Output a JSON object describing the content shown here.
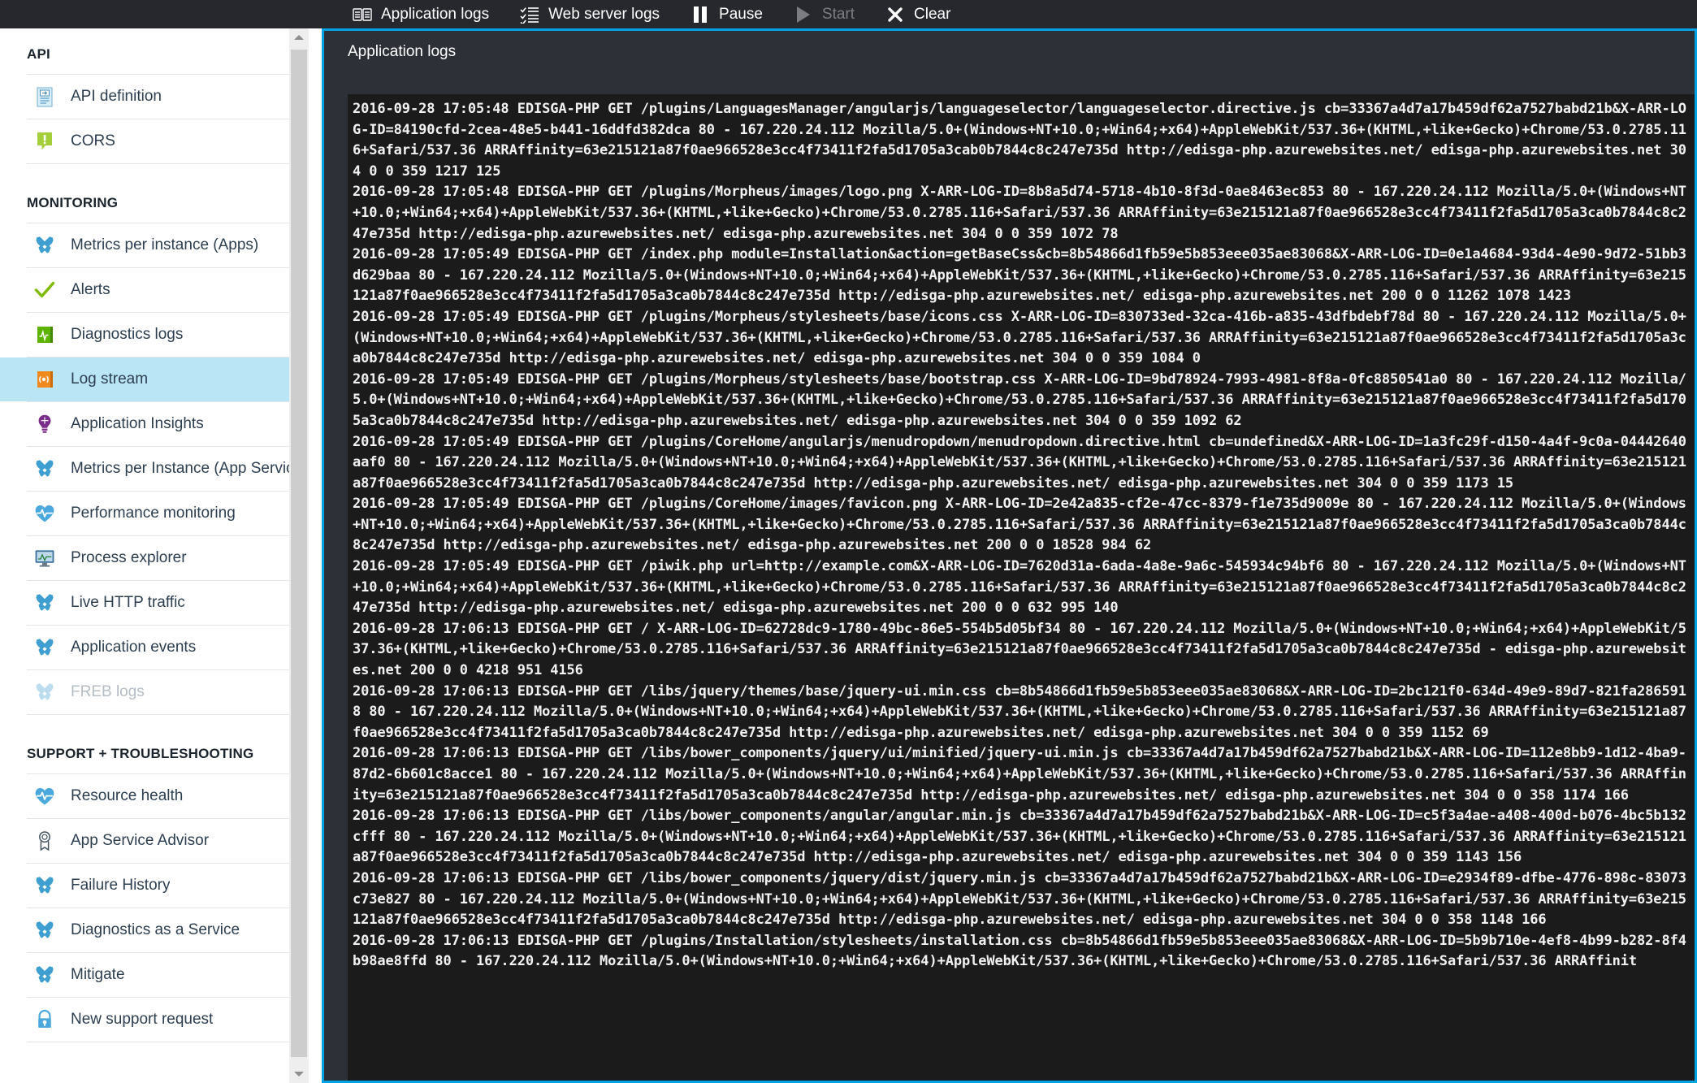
{
  "toolbar": {
    "buttons": [
      {
        "label": "Application logs",
        "icon": "book-icon",
        "disabled": false
      },
      {
        "label": "Web server logs",
        "icon": "checklist-icon",
        "disabled": false
      },
      {
        "label": "Pause",
        "icon": "pause-icon",
        "disabled": false
      },
      {
        "label": "Start",
        "icon": "play-icon",
        "disabled": true
      },
      {
        "label": "Clear",
        "icon": "close-x-icon",
        "disabled": false
      }
    ]
  },
  "sidebar": {
    "groups": [
      {
        "title": "API",
        "items": [
          {
            "label": "API definition",
            "icon": "api-definition-icon",
            "selected": false,
            "disabled": false
          },
          {
            "label": "CORS",
            "icon": "cors-icon",
            "selected": false,
            "disabled": false
          }
        ]
      },
      {
        "title": "MONITORING",
        "items": [
          {
            "label": "Metrics per instance (Apps)",
            "icon": "tools-icon",
            "selected": false,
            "disabled": false
          },
          {
            "label": "Alerts",
            "icon": "checkmark-icon",
            "selected": false,
            "disabled": false
          },
          {
            "label": "Diagnostics logs",
            "icon": "diagnostics-logs-icon",
            "selected": false,
            "disabled": false
          },
          {
            "label": "Log stream",
            "icon": "log-stream-icon",
            "selected": true,
            "disabled": false
          },
          {
            "label": "Application Insights",
            "icon": "lightbulb-icon",
            "selected": false,
            "disabled": false
          },
          {
            "label": "Metrics per Instance (App Servic...",
            "icon": "tools-icon",
            "selected": false,
            "disabled": false
          },
          {
            "label": "Performance monitoring",
            "icon": "heart-pulse-icon",
            "selected": false,
            "disabled": false
          },
          {
            "label": "Process explorer",
            "icon": "monitor-icon",
            "selected": false,
            "disabled": false
          },
          {
            "label": "Live HTTP traffic",
            "icon": "tools-icon",
            "selected": false,
            "disabled": false
          },
          {
            "label": "Application events",
            "icon": "tools-icon",
            "selected": false,
            "disabled": false
          },
          {
            "label": "FREB logs",
            "icon": "tools-icon",
            "selected": false,
            "disabled": true
          }
        ]
      },
      {
        "title": "SUPPORT + TROUBLESHOOTING",
        "items": [
          {
            "label": "Resource health",
            "icon": "heart-pulse-icon",
            "selected": false,
            "disabled": false
          },
          {
            "label": "App Service Advisor",
            "icon": "ribbon-icon",
            "selected": false,
            "disabled": false
          },
          {
            "label": "Failure History",
            "icon": "tools-icon",
            "selected": false,
            "disabled": false
          },
          {
            "label": "Diagnostics as a Service",
            "icon": "tools-icon",
            "selected": false,
            "disabled": false
          },
          {
            "label": "Mitigate",
            "icon": "tools-icon",
            "selected": false,
            "disabled": false
          },
          {
            "label": "New support request",
            "icon": "support-request-icon",
            "selected": false,
            "disabled": false
          }
        ]
      }
    ]
  },
  "log_panel": {
    "title": "Application logs",
    "lines": [
      "2016-09-28 17:05:48 EDISGA-PHP GET /plugins/LanguagesManager/angularjs/languageselector/languageselector.directive.js cb=33367a4d7a17b459df62a7527babd21b&X-ARR-LOG-ID=84190cfd-2cea-48e5-b441-16ddfd382dca 80 - 167.220.24.112 Mozilla/5.0+(Windows+NT+10.0;+Win64;+x64)+AppleWebKit/537.36+(KHTML,+like+Gecko)+Chrome/53.0.2785.116+Safari/537.36 ARRAffinity=63e215121a87f0ae966528e3cc4f73411f2fa5d1705a3cab0b7844c8c247e735d http://edisga-php.azurewebsites.net/ edisga-php.azurewebsites.net 304 0 0 359 1217 125",
      "2016-09-28 17:05:48 EDISGA-PHP GET /plugins/Morpheus/images/logo.png X-ARR-LOG-ID=8b8a5d74-5718-4b10-8f3d-0ae8463ec853 80 - 167.220.24.112 Mozilla/5.0+(Windows+NT+10.0;+Win64;+x64)+AppleWebKit/537.36+(KHTML,+like+Gecko)+Chrome/53.0.2785.116+Safari/537.36 ARRAffinity=63e215121a87f0ae966528e3cc4f73411f2fa5d1705a3ca0b7844c8c247e735d http://edisga-php.azurewebsites.net/ edisga-php.azurewebsites.net 304 0 0 359 1072 78",
      "2016-09-28 17:05:49 EDISGA-PHP GET /index.php module=Installation&action=getBaseCss&cb=8b54866d1fb59e5b853eee035ae83068&X-ARR-LOG-ID=0e1a4684-93d4-4e90-9d72-51bb3d629baa 80 - 167.220.24.112 Mozilla/5.0+(Windows+NT+10.0;+Win64;+x64)+AppleWebKit/537.36+(KHTML,+like+Gecko)+Chrome/53.0.2785.116+Safari/537.36 ARRAffinity=63e215121a87f0ae966528e3cc4f73411f2fa5d1705a3ca0b7844c8c247e735d http://edisga-php.azurewebsites.net/ edisga-php.azurewebsites.net 200 0 0 11262 1078 1423",
      "2016-09-28 17:05:49 EDISGA-PHP GET /plugins/Morpheus/stylesheets/base/icons.css X-ARR-LOG-ID=830733ed-32ca-416b-a835-43dfbdebf78d 80 - 167.220.24.112 Mozilla/5.0+(Windows+NT+10.0;+Win64;+x64)+AppleWebKit/537.36+(KHTML,+like+Gecko)+Chrome/53.0.2785.116+Safari/537.36 ARRAffinity=63e215121a87f0ae966528e3cc4f73411f2fa5d1705a3ca0b7844c8c247e735d http://edisga-php.azurewebsites.net/ edisga-php.azurewebsites.net 304 0 0 359 1084 0",
      "2016-09-28 17:05:49 EDISGA-PHP GET /plugins/Morpheus/stylesheets/base/bootstrap.css X-ARR-LOG-ID=9bd78924-7993-4981-8f8a-0fc8850541a0 80 - 167.220.24.112 Mozilla/5.0+(Windows+NT+10.0;+Win64;+x64)+AppleWebKit/537.36+(KHTML,+like+Gecko)+Chrome/53.0.2785.116+Safari/537.36 ARRAffinity=63e215121a87f0ae966528e3cc4f73411f2fa5d1705a3ca0b7844c8c247e735d http://edisga-php.azurewebsites.net/ edisga-php.azurewebsites.net 304 0 0 359 1092 62",
      "2016-09-28 17:05:49 EDISGA-PHP GET /plugins/CoreHome/angularjs/menudropdown/menudropdown.directive.html cb=undefined&X-ARR-LOG-ID=1a3fc29f-d150-4a4f-9c0a-04442640aaf0 80 - 167.220.24.112 Mozilla/5.0+(Windows+NT+10.0;+Win64;+x64)+AppleWebKit/537.36+(KHTML,+like+Gecko)+Chrome/53.0.2785.116+Safari/537.36 ARRAffinity=63e215121a87f0ae966528e3cc4f73411f2fa5d1705a3ca0b7844c8c247e735d http://edisga-php.azurewebsites.net/ edisga-php.azurewebsites.net 304 0 0 359 1173 15",
      "2016-09-28 17:05:49 EDISGA-PHP GET /plugins/CoreHome/images/favicon.png X-ARR-LOG-ID=2e42a835-cf2e-47cc-8379-f1e735d9009e 80 - 167.220.24.112 Mozilla/5.0+(Windows+NT+10.0;+Win64;+x64)+AppleWebKit/537.36+(KHTML,+like+Gecko)+Chrome/53.0.2785.116+Safari/537.36 ARRAffinity=63e215121a87f0ae966528e3cc4f73411f2fa5d1705a3ca0b7844c8c247e735d http://edisga-php.azurewebsites.net/ edisga-php.azurewebsites.net 200 0 0 18528 984 62",
      "2016-09-28 17:05:49 EDISGA-PHP GET /piwik.php url=http://example.com&X-ARR-LOG-ID=7620d31a-6ada-4a8e-9a6c-545934c94bf6 80 - 167.220.24.112 Mozilla/5.0+(Windows+NT+10.0;+Win64;+x64)+AppleWebKit/537.36+(KHTML,+like+Gecko)+Chrome/53.0.2785.116+Safari/537.36 ARRAffinity=63e215121a87f0ae966528e3cc4f73411f2fa5d1705a3ca0b7844c8c247e735d http://edisga-php.azurewebsites.net/ edisga-php.azurewebsites.net 200 0 0 632 995 140",
      "2016-09-28 17:06:13 EDISGA-PHP GET / X-ARR-LOG-ID=62728dc9-1780-49bc-86e5-554b5d05bf34 80 - 167.220.24.112 Mozilla/5.0+(Windows+NT+10.0;+Win64;+x64)+AppleWebKit/537.36+(KHTML,+like+Gecko)+Chrome/53.0.2785.116+Safari/537.36 ARRAffinity=63e215121a87f0ae966528e3cc4f73411f2fa5d1705a3ca0b7844c8c247e735d - edisga-php.azurewebsites.net 200 0 0 4218 951 4156",
      "2016-09-28 17:06:13 EDISGA-PHP GET /libs/jquery/themes/base/jquery-ui.min.css cb=8b54866d1fb59e5b853eee035ae83068&X-ARR-LOG-ID=2bc121f0-634d-49e9-89d7-821fa2865918 80 - 167.220.24.112 Mozilla/5.0+(Windows+NT+10.0;+Win64;+x64)+AppleWebKit/537.36+(KHTML,+like+Gecko)+Chrome/53.0.2785.116+Safari/537.36 ARRAffinity=63e215121a87f0ae966528e3cc4f73411f2fa5d1705a3ca0b7844c8c247e735d http://edisga-php.azurewebsites.net/ edisga-php.azurewebsites.net 304 0 0 359 1152 69",
      "2016-09-28 17:06:13 EDISGA-PHP GET /libs/bower_components/jquery/ui/minified/jquery-ui.min.js cb=33367a4d7a17b459df62a7527babd21b&X-ARR-LOG-ID=112e8bb9-1d12-4ba9-87d2-6b601c8acce1 80 - 167.220.24.112 Mozilla/5.0+(Windows+NT+10.0;+Win64;+x64)+AppleWebKit/537.36+(KHTML,+like+Gecko)+Chrome/53.0.2785.116+Safari/537.36 ARRAffinity=63e215121a87f0ae966528e3cc4f73411f2fa5d1705a3ca0b7844c8c247e735d http://edisga-php.azurewebsites.net/ edisga-php.azurewebsites.net 304 0 0 358 1174 166",
      "2016-09-28 17:06:13 EDISGA-PHP GET /libs/bower_components/angular/angular.min.js cb=33367a4d7a17b459df62a7527babd21b&X-ARR-LOG-ID=c5f3a4ae-a408-400d-b076-4bc5b132cfff 80 - 167.220.24.112 Mozilla/5.0+(Windows+NT+10.0;+Win64;+x64)+AppleWebKit/537.36+(KHTML,+like+Gecko)+Chrome/53.0.2785.116+Safari/537.36 ARRAffinity=63e215121a87f0ae966528e3cc4f73411f2fa5d1705a3ca0b7844c8c247e735d http://edisga-php.azurewebsites.net/ edisga-php.azurewebsites.net 304 0 0 359 1143 156",
      "2016-09-28 17:06:13 EDISGA-PHP GET /libs/bower_components/jquery/dist/jquery.min.js cb=33367a4d7a17b459df62a7527babd21b&X-ARR-LOG-ID=e2934f89-dfbe-4776-898c-83073c73e827 80 - 167.220.24.112 Mozilla/5.0+(Windows+NT+10.0;+Win64;+x64)+AppleWebKit/537.36+(KHTML,+like+Gecko)+Chrome/53.0.2785.116+Safari/537.36 ARRAffinity=63e215121a87f0ae966528e3cc4f73411f2fa5d1705a3ca0b7844c8c247e735d http://edisga-php.azurewebsites.net/ edisga-php.azurewebsites.net 304 0 0 358 1148 166",
      "2016-09-28 17:06:13 EDISGA-PHP GET /plugins/Installation/stylesheets/installation.css cb=8b54866d1fb59e5b853eee035ae83068&X-ARR-LOG-ID=5b9b710e-4ef8-4b99-b282-8f4b98ae8ffd 80 - 167.220.24.112 Mozilla/5.0+(Windows+NT+10.0;+Win64;+x64)+AppleWebKit/537.36+(KHTML,+like+Gecko)+Chrome/53.0.2785.116+Safari/537.36 ARRAffinit"
    ]
  }
}
